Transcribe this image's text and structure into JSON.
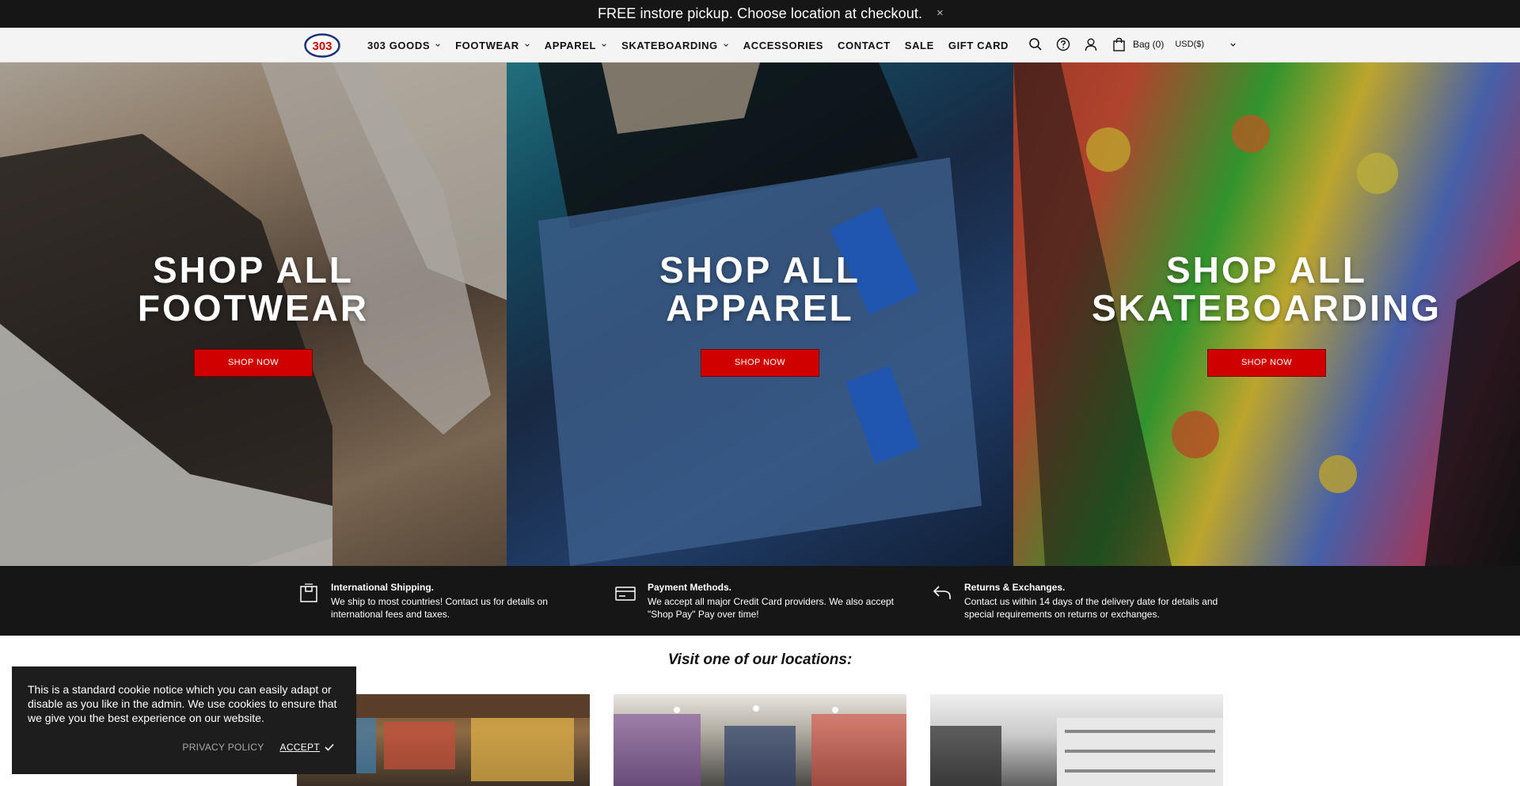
{
  "announcement": {
    "text": "FREE instore pickup. Choose location at checkout.",
    "close": "×"
  },
  "header": {
    "logo_text": "303",
    "nav": [
      {
        "label": "303 GOODS",
        "has_dropdown": true
      },
      {
        "label": "FOOTWEAR",
        "has_dropdown": true
      },
      {
        "label": "APPAREL",
        "has_dropdown": true
      },
      {
        "label": "SKATEBOARDING",
        "has_dropdown": true
      },
      {
        "label": "ACCESSORIES",
        "has_dropdown": false
      },
      {
        "label": "CONTACT",
        "has_dropdown": false
      },
      {
        "label": "SALE",
        "has_dropdown": false
      },
      {
        "label": "GIFT CARD",
        "has_dropdown": false
      }
    ],
    "icons": [
      "search-icon",
      "help-icon",
      "account-icon",
      "bag-icon"
    ],
    "bag_label": "Bag (0)",
    "currency": "USD($)"
  },
  "hero": {
    "panels": [
      {
        "title_line1": "SHOP ALL",
        "title_line2": "FOOTWEAR",
        "button": "SHOP NOW"
      },
      {
        "title_line1": "SHOP ALL",
        "title_line2": "APPAREL",
        "button": "SHOP NOW"
      },
      {
        "title_line1": "SHOP ALL",
        "title_line2": "SKATEBOARDING",
        "button": "SHOP NOW"
      }
    ]
  },
  "info": {
    "items": [
      {
        "icon": "package-icon",
        "title": "International Shipping.",
        "line1": "We ship to most countries! Contact us for details on",
        "line2": "international fees and taxes."
      },
      {
        "icon": "credit-card-icon",
        "title": "Payment Methods.",
        "line1": "We accept all major Credit Card providers. We also accept",
        "line2": "\"Shop Pay\" Pay over time!"
      },
      {
        "icon": "return-arrow-icon",
        "title": "Returns & Exchanges.",
        "line1": "Contact us within 14 days of the delivery date for details and",
        "line2": "special requirements on returns or exchanges."
      }
    ]
  },
  "locations": {
    "title": "Visit one of our locations:"
  },
  "cookie": {
    "text": "This is a standard cookie notice which you can easily adapt or disable as you like in the admin. We use cookies to ensure that we give you the best experience on our website.",
    "privacy": "PRIVACY POLICY",
    "accept": "ACCEPT"
  },
  "colors": {
    "accent_red": "#d10000",
    "dark_bar": "#161616",
    "header_bg": "#f4f4f4"
  }
}
